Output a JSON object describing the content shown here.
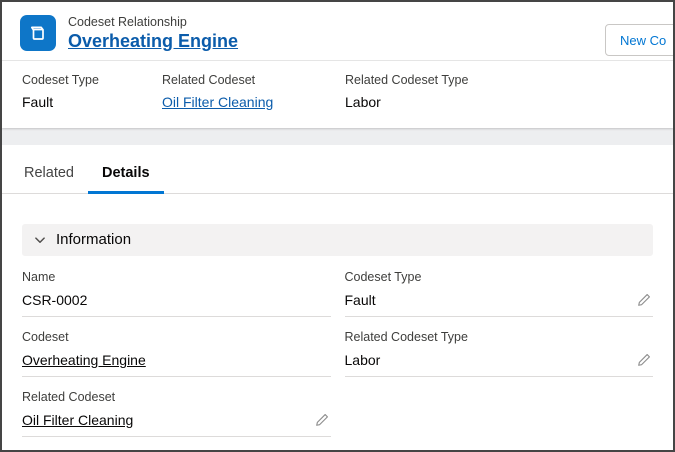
{
  "colors": {
    "brand_blue": "#0b5cab",
    "link_blue": "#0b5cab",
    "active_tab_underline": "#0176d3",
    "entity_icon_bg": "#0e76c8",
    "section_header_bg": "#f3f2f2"
  },
  "header": {
    "entity_label": "Codeset Relationship",
    "record_title": "Overheating Engine",
    "new_button_label": "New Co"
  },
  "highlights": {
    "fields": [
      {
        "label": "Codeset Type",
        "value": "Fault"
      },
      {
        "label": "Related Codeset",
        "value": "Oil Filter Cleaning"
      },
      {
        "label": "Related Codeset Type",
        "value": "Labor"
      }
    ]
  },
  "tabs": {
    "related_label": "Related",
    "details_label": "Details"
  },
  "information": {
    "title": "Information",
    "fields": {
      "name": {
        "label": "Name",
        "value": "CSR-0002"
      },
      "codeset_type": {
        "label": "Codeset Type",
        "value": "Fault"
      },
      "codeset": {
        "label": "Codeset",
        "value": "Overheating Engine"
      },
      "related_codeset_type": {
        "label": "Related Codeset Type",
        "value": "Labor"
      },
      "related_codeset": {
        "label": "Related Codeset",
        "value": "Oil Filter Cleaning"
      }
    }
  },
  "icons": {
    "entity_icon": "codeset-box-icon",
    "chevron": "chevron-down-icon",
    "edit": "edit-pencil-icon"
  }
}
